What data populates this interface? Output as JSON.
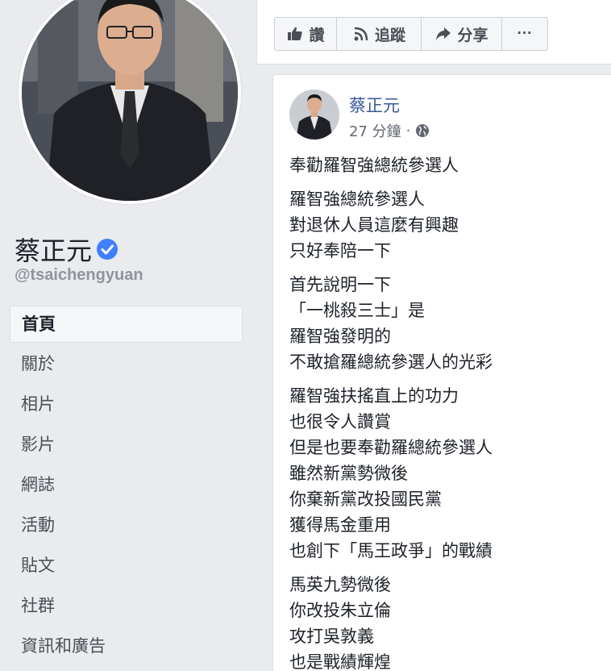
{
  "profile": {
    "name": "蔡正元",
    "handle": "@tsaichengyuan"
  },
  "nav": {
    "items": [
      {
        "label": "首頁",
        "active": true
      },
      {
        "label": "關於"
      },
      {
        "label": "相片"
      },
      {
        "label": "影片"
      },
      {
        "label": "網誌"
      },
      {
        "label": "活動"
      },
      {
        "label": "貼文"
      },
      {
        "label": "社群"
      },
      {
        "label": "資訊和廣告"
      }
    ]
  },
  "actions": {
    "like": "讚",
    "follow": "追蹤",
    "share": "分享",
    "more": "···"
  },
  "post": {
    "author": "蔡正元",
    "time": "27 分鐘",
    "dot": "·",
    "paragraphs": [
      [
        "奉勸羅智強總統參選人"
      ],
      [
        "羅智強總統參選人",
        "對退休人員這麼有興趣",
        "只好奉陪一下"
      ],
      [
        "首先說明一下",
        "「一桃殺三士」是",
        "羅智強發明的",
        "不敢搶羅總統參選人的光彩"
      ],
      [
        "羅智強扶搖直上的功力",
        "也很令人讚賞",
        "但是也要奉勸羅總統參選人",
        "雖然新黨勢微後",
        "你棄新黨改投國民黨",
        "獲得馬金重用",
        "也創下「馬王政爭」的戰績"
      ],
      [
        "馬英九勢微後",
        "你改投朱立倫",
        "攻打吳敦義",
        "也是戰績輝煌"
      ]
    ]
  },
  "colors": {
    "link": "#385898",
    "verified": "#4080ff",
    "page_bg": "#e9ebee"
  }
}
